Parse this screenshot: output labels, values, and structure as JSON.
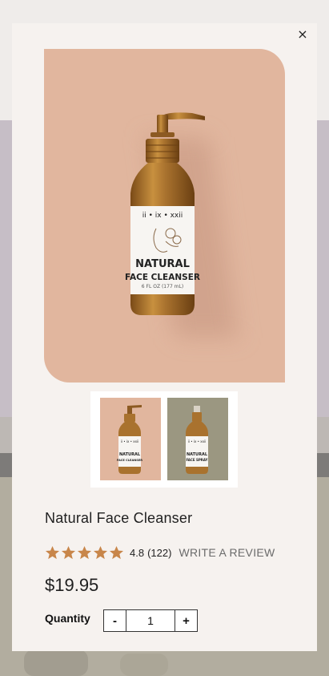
{
  "product": {
    "title": "Natural Face Cleanser",
    "rating_score": "4.8",
    "review_count": "(122)",
    "rating_value": 4.8,
    "rating_max": 5,
    "write_review_label": "WRITE A REVIEW",
    "price": "$19.95"
  },
  "label_art": {
    "brand": "ii • ix • xxii",
    "line1": "NATURAL",
    "line2": "FACE CLEANSER",
    "volume": "6 FL OZ (177 mL)",
    "thumb2_line1": "NATURAL",
    "thumb2_line2": "FACE SPRAY"
  },
  "quantity": {
    "label": "Quantity",
    "value": "1",
    "minus_label": "-",
    "plus_label": "+"
  },
  "modal": {
    "close_label": "×"
  },
  "colors": {
    "hero_bg": "#e1b69e",
    "thumb2_bg": "#9b9781",
    "star": "#c8864a",
    "bottle": "#a9722e"
  },
  "icons": [
    "close-icon",
    "star-icon"
  ]
}
